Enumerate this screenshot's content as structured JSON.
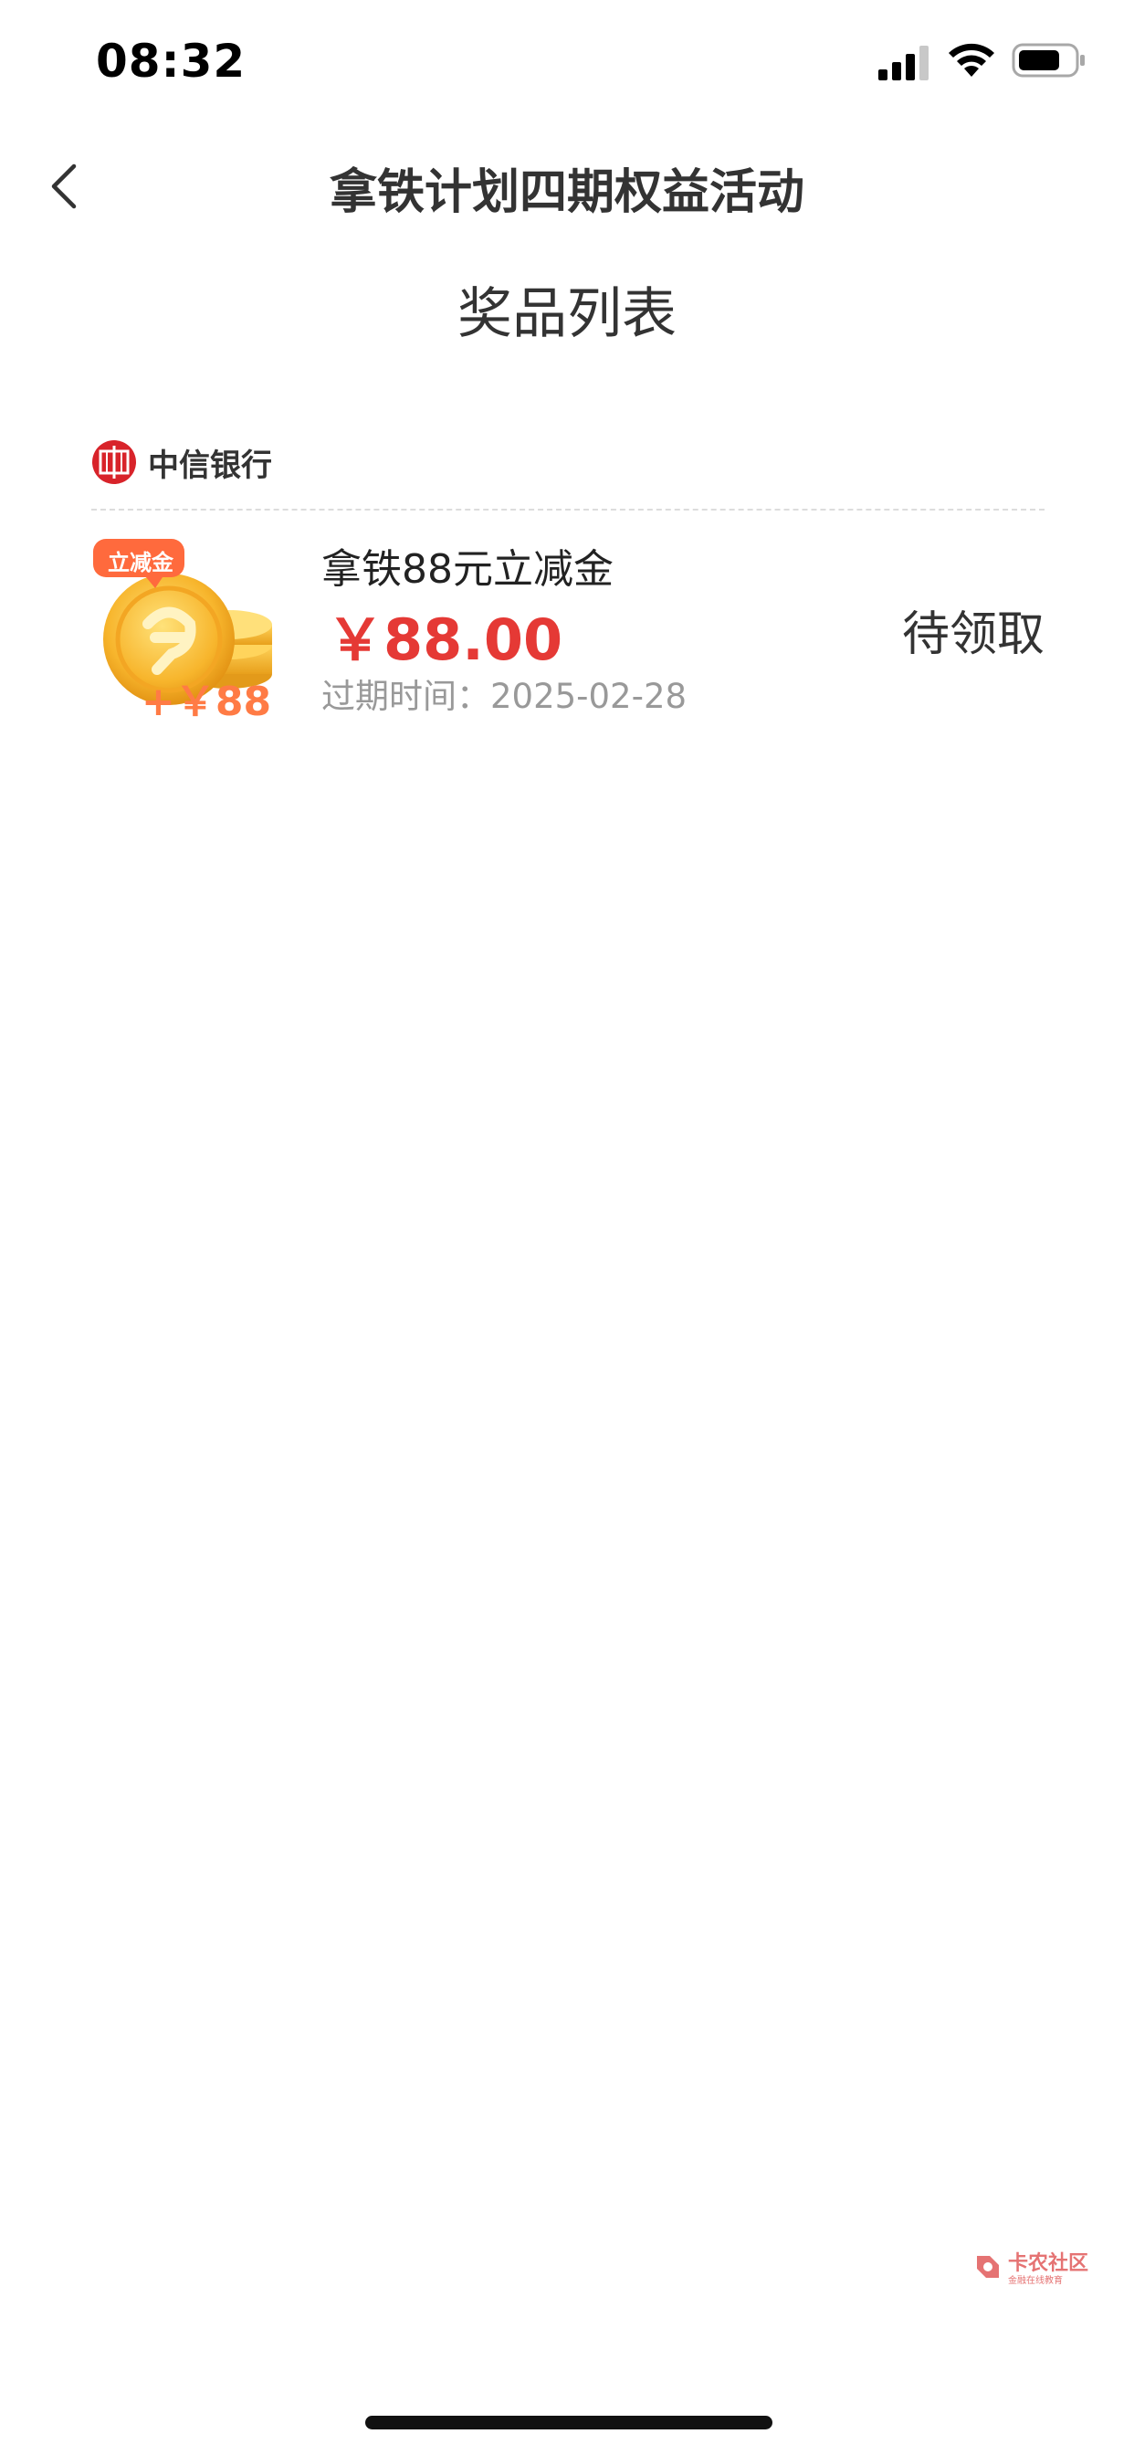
{
  "status_bar": {
    "time": "08:32",
    "icons": [
      "signal-icon",
      "wifi-icon",
      "battery-icon"
    ]
  },
  "nav": {
    "title": "拿铁计划四期权益活动",
    "back_icon": "chevron-left-icon"
  },
  "section": {
    "title": "奖品列表"
  },
  "bank": {
    "name": "中信银行",
    "logo_icon": "citic-bank-logo"
  },
  "prizes": [
    {
      "name": "拿铁88元立减金",
      "amount": "￥88.00",
      "expiry": "过期时间：2025-02-28",
      "status": "待领取",
      "image": {
        "badge": "立减金",
        "caption": "+￥88"
      }
    }
  ],
  "watermark": {
    "text": "卡农社区",
    "subtext": "金融在线教育"
  },
  "colors": {
    "accent_red": "#e53935",
    "text_primary": "#333333",
    "text_secondary": "#999999",
    "coin_gold": "#f5b82e",
    "badge_orange": "#ff6a3d"
  }
}
